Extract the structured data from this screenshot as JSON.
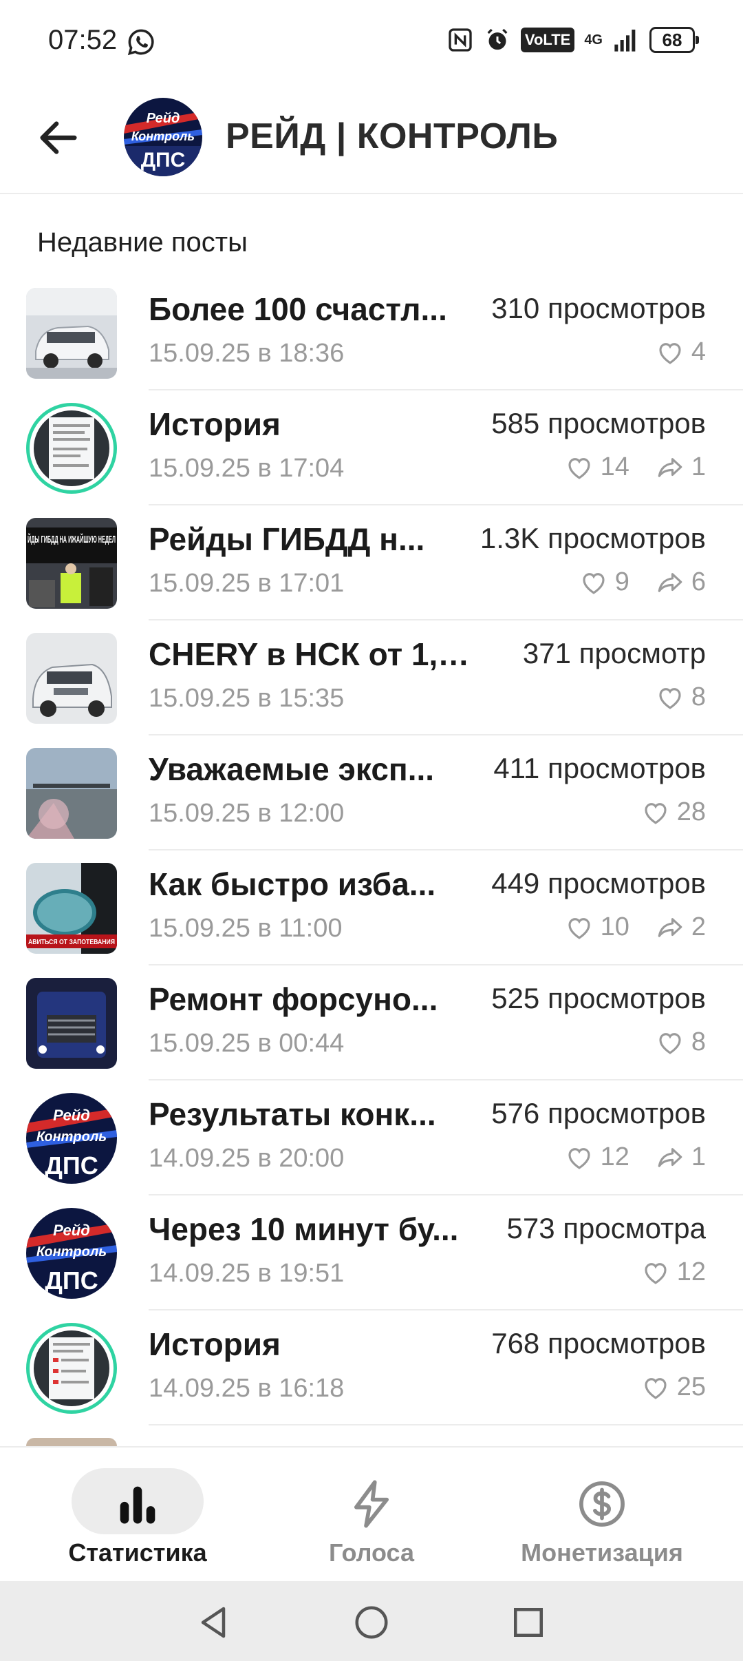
{
  "status_bar": {
    "time": "07:52",
    "battery": "68",
    "volte": "VoLTE",
    "network": "4G"
  },
  "header": {
    "title": "РЕЙД | КОНТРОЛЬ",
    "avatar_text_1": "Рейд",
    "avatar_text_2": "Контроль",
    "avatar_text_3": "ДПС"
  },
  "section_title": "Недавние посты",
  "posts": [
    {
      "title": "Более 100 счастл...",
      "date": "15.09.25 в 18:36",
      "views": "310 просмотров",
      "likes": "4",
      "shares": ""
    },
    {
      "title": "История",
      "date": "15.09.25 в 17:04",
      "views": "585 просмотров",
      "likes": "14",
      "shares": "1"
    },
    {
      "title": "Рейды ГИБДД н...",
      "date": "15.09.25 в 17:01",
      "views": "1.3K просмотров",
      "likes": "9",
      "shares": "6",
      "thumb_text": "ЙДЫ ГИБДД НА ИЖАЙШУЮ НЕДЕЛ"
    },
    {
      "title": "CHERY в НСК от 1,5...",
      "date": "15.09.25 в 15:35",
      "views": "371 просмотр",
      "likes": "8",
      "shares": ""
    },
    {
      "title": "Уважаемые эксп...",
      "date": "15.09.25 в 12:00",
      "views": "411 просмотров",
      "likes": "28",
      "shares": ""
    },
    {
      "title": "Как быстро изба...",
      "date": "15.09.25 в 11:00",
      "views": "449 просмотров",
      "likes": "10",
      "shares": "2",
      "thumb_text": "АВИТЬСЯ ОТ ЗАПОТЕВАНИЯ"
    },
    {
      "title": "Ремонт форсуно...",
      "date": "15.09.25 в 00:44",
      "views": "525 просмотров",
      "likes": "8",
      "shares": ""
    },
    {
      "title": "Результаты конк...",
      "date": "14.09.25 в 20:00",
      "views": "576 просмотров",
      "likes": "12",
      "shares": "1"
    },
    {
      "title": "Через 10 минут бу...",
      "date": "14.09.25 в 19:51",
      "views": "573 просмотра",
      "likes": "12",
      "shares": ""
    },
    {
      "title": "История",
      "date": "14.09.25 в 16:18",
      "views": "768 просмотров",
      "likes": "25",
      "shares": ""
    }
  ],
  "bottom_nav": [
    {
      "label": "Статистика",
      "icon": "bar-chart-icon",
      "active": true
    },
    {
      "label": "Голоса",
      "icon": "lightning-icon",
      "active": false
    },
    {
      "label": "Монетизация",
      "icon": "dollar-icon",
      "active": false
    }
  ],
  "colors": {
    "story_ring": "#2fd3a2",
    "divider": "#ececec",
    "muted": "#9a9a9a"
  }
}
